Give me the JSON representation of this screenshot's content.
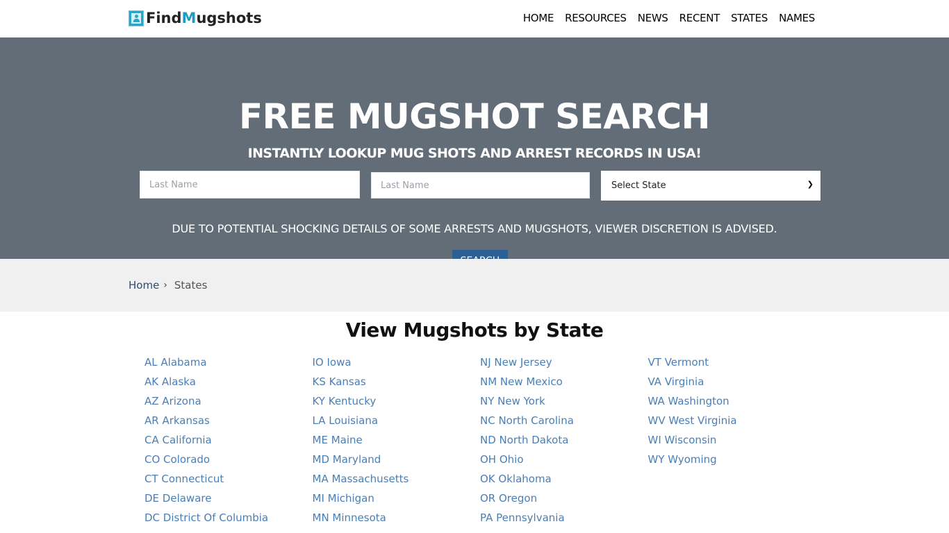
{
  "header": {
    "logo": {
      "part1": "Find",
      "part2": "M",
      "part3": "ugshots",
      "icon": "id-card-icon"
    },
    "nav": [
      "HOME",
      "RESOURCES",
      "NEWS",
      "RECENT",
      "STATES",
      "NAMES"
    ]
  },
  "hero": {
    "title": "FREE MUGSHOT SEARCH",
    "subtitle": "INSTANTLY LOOKUP MUG SHOTS AND ARREST RECORDS IN USA!",
    "first_input_placeholder": "Last Name",
    "second_input_placeholder": "Last Name",
    "state_select_value": "Select State",
    "warning": "DUE TO POTENTIAL SHOCKING DETAILS OF SOME ARRESTS AND MUGSHOTS, VIEWER DISCRETION IS ADVISED.",
    "search_button": "SEARCH"
  },
  "breadcrumb": {
    "home": "Home",
    "separator": "›",
    "current": "States"
  },
  "main": {
    "title": "View Mugshots by State",
    "columns": [
      [
        "AL Alabama",
        "AK Alaska",
        "AZ Arizona",
        "AR Arkansas",
        "CA California",
        "CO Colorado",
        "CT Connecticut",
        "DE Delaware",
        "DC District Of Columbia"
      ],
      [
        "IO Iowa",
        "KS Kansas",
        "KY Kentucky",
        "LA Louisiana",
        "ME Maine",
        "MD Maryland",
        "MA Massachusetts",
        "MI Michigan",
        "MN Minnesota"
      ],
      [
        "NJ New Jersey",
        "NM New Mexico",
        "NY New York",
        "NC North Carolina",
        "ND North Dakota",
        "OH Ohio",
        "OK Oklahoma",
        "OR Oregon",
        "PA Pennsylvania"
      ],
      [
        "VT Vermont",
        "VA Virginia",
        "WA Washington",
        "WV West Virginia",
        "WI Wisconsin",
        "WY Wyoming"
      ]
    ]
  },
  "colors": {
    "hero_bg": "#636d78",
    "button": "#2c5f93",
    "link": "#4a7fb5",
    "logo_accent": "#1e9bc4"
  }
}
